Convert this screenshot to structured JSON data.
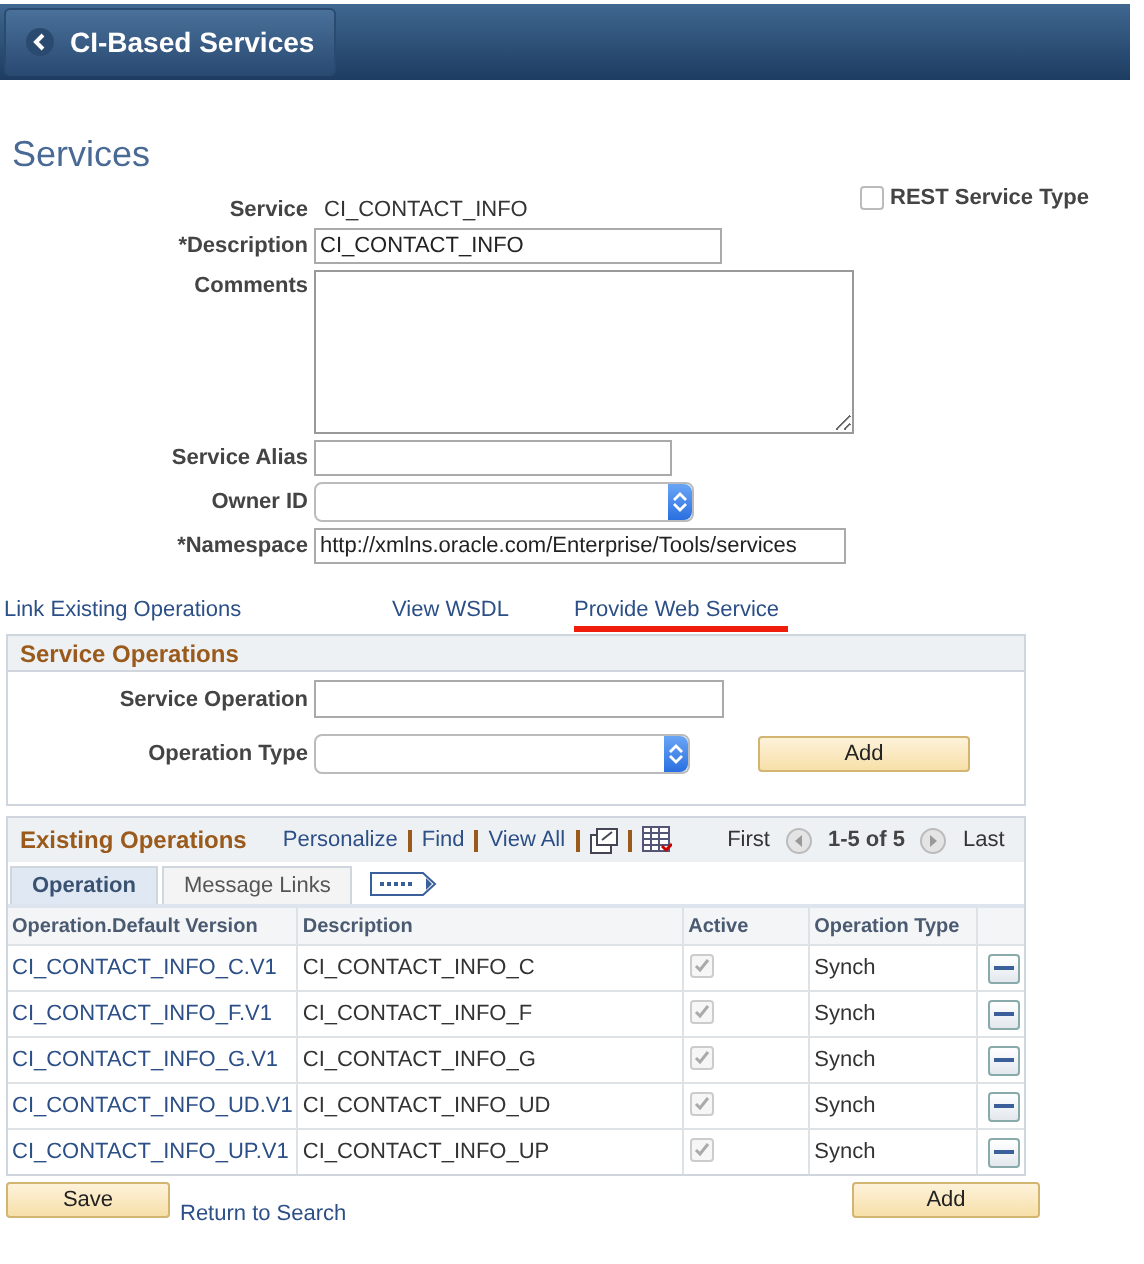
{
  "header": {
    "back_label": "CI-Based Services"
  },
  "page_title": "Services",
  "fields": [
    {
      "kind": "text",
      "label": "Service",
      "value": "CI_CONTACT_INFO"
    },
    {
      "kind": "input",
      "label": "*Description",
      "value": "CI_CONTACT_INFO"
    },
    {
      "kind": "textarea",
      "label": "Comments"
    },
    {
      "kind": "input",
      "label": "Service Alias"
    },
    {
      "kind": "select",
      "label": "Owner ID"
    },
    {
      "kind": "input",
      "label": "*Namespace",
      "value": "http://xmlns.oracle.com/Enterprise/Tools/services"
    }
  ],
  "rest_checkbox": {
    "label": "REST Service Type",
    "checked": false
  },
  "links": [
    {
      "label": "Link Existing Operations",
      "underlined": false
    },
    {
      "label": "View WSDL",
      "underlined": false
    },
    {
      "label": "Provide Web Service",
      "underlined": true
    }
  ],
  "service_operations": {
    "title": "Service Operations",
    "fields": [
      {
        "kind": "input",
        "label": "Service Operation"
      },
      {
        "kind": "select",
        "label": "Operation Type"
      }
    ],
    "button": "Add"
  },
  "existing": {
    "title": "Existing Operations",
    "toolbar": [
      "Personalize",
      "Find",
      "View All"
    ],
    "first": "First",
    "range": "1-5 of 5",
    "last": "Last",
    "tabs": [
      {
        "label": "Operation",
        "selected": true
      },
      {
        "label": "Message Links",
        "selected": false
      }
    ],
    "columns": [
      "Operation.Default Version",
      "Description",
      "Active",
      "Operation Type"
    ],
    "rows": [
      {
        "operation": "CI_CONTACT_INFO_C.V1",
        "description": "CI_CONTACT_INFO_C",
        "active": true,
        "type": "Synch"
      },
      {
        "operation": "CI_CONTACT_INFO_F.V1",
        "description": "CI_CONTACT_INFO_F",
        "active": true,
        "type": "Synch"
      },
      {
        "operation": "CI_CONTACT_INFO_G.V1",
        "description": "CI_CONTACT_INFO_G",
        "active": true,
        "type": "Synch"
      },
      {
        "operation": "CI_CONTACT_INFO_UD.V1",
        "description": "CI_CONTACT_INFO_UD",
        "active": true,
        "type": "Synch"
      },
      {
        "operation": "CI_CONTACT_INFO_UP.V1",
        "description": "CI_CONTACT_INFO_UP",
        "active": true,
        "type": "Synch"
      }
    ]
  },
  "footer": {
    "save": "Save",
    "return": "Return to Search",
    "add": "Add"
  }
}
